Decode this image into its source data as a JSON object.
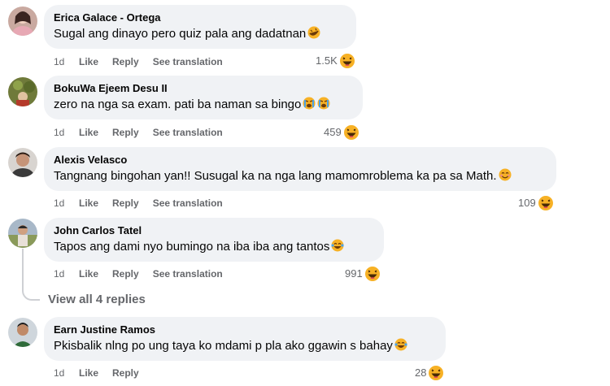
{
  "comments": [
    {
      "author": "Erica Galace - Ortega",
      "text": "Sugal ang dinayo pero quiz pala ang dadatnan",
      "inline_emoji": "rolling-laugh-emoji",
      "time": "1d",
      "like": "Like",
      "reply": "Reply",
      "see_translation": "See translation",
      "reaction_count": "1.5K",
      "reaction": "haha-reaction"
    },
    {
      "author": "BokuWa Ejeem Desu II",
      "text": "zero na nga sa exam. pati ba naman sa bingo",
      "inline_emoji": "crying-emoji x2",
      "time": "1d",
      "like": "Like",
      "reply": "Reply",
      "see_translation": "See translation",
      "reaction_count": "459",
      "reaction": "haha-reaction"
    },
    {
      "author": "Alexis Velasco",
      "text": "Tangnang bingohan yan!! Susugal ka na nga lang mamomroblema ka pa sa Math.",
      "inline_emoji": "smile-emoji",
      "time": "1d",
      "like": "Like",
      "reply": "Reply",
      "see_translation": "See translation",
      "reaction_count": "109",
      "reaction": "haha-reaction"
    },
    {
      "author": "John Carlos Tatel",
      "text": "Tapos ang dami nyo bumingo na iba iba ang tantos",
      "inline_emoji": "laugh-tears-emoji",
      "time": "1d",
      "like": "Like",
      "reply": "Reply",
      "see_translation": "See translation",
      "reaction_count": "991",
      "reaction": "haha-reaction"
    },
    {
      "author": "Earn Justine Ramos",
      "text": "Pkisbalik nlng po ung taya ko mdami p pla ako ggawin s bahay",
      "inline_emoji": "laugh-tears-emoji",
      "time": "1d",
      "like": "Like",
      "reply": "Reply",
      "reaction_count": "28",
      "reaction": "haha-reaction"
    }
  ],
  "view_replies": "View all 4 replies",
  "colors": {
    "bubble": "#f0f2f5",
    "meta": "#65676b",
    "text": "#050505",
    "haha": "#f7b125"
  }
}
